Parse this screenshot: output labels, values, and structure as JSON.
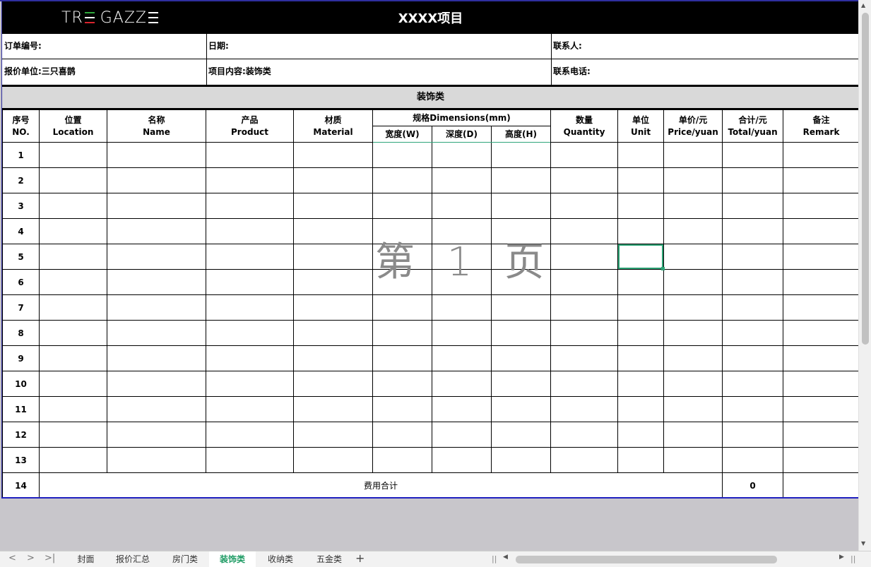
{
  "header": {
    "logo": "TRE GAZZE",
    "title": "XXXX项目",
    "logo_stripe_colors": [
      "#2fa83c",
      "#ffffff",
      "#d8242d"
    ]
  },
  "info": {
    "order_no_label": "订单编号:",
    "date_label": "日期:",
    "contact_label": "联系人:",
    "quote_unit_label": "报价单位:三只喜鹊",
    "project_content_label": "项目内容:装饰类",
    "phone_label": "联系电话:"
  },
  "section_title": "装饰类",
  "columns": {
    "no_cn": "序号",
    "no_en": "NO.",
    "loc_cn": "位置",
    "loc_en": "Location",
    "name_cn": "名称",
    "name_en": "Name",
    "prod_cn": "产品",
    "prod_en": "Product",
    "mat_cn": "材质",
    "mat_en": "Material",
    "dim": "规格Dimensions(mm)",
    "w": "宽度(W)",
    "d": "深度(D)",
    "h": "高度(H)",
    "qty_cn": "数量",
    "qty_en": "Quantity",
    "unit_cn": "单位",
    "unit_en": "Unit",
    "price_cn": "单价/元",
    "price_en": "Price/yuan",
    "total_cn": "合计/元",
    "total_en": "Total/yuan",
    "remark_cn": "备注",
    "remark_en": "Remark"
  },
  "rows": [
    "1",
    "2",
    "3",
    "4",
    "5",
    "6",
    "7",
    "8",
    "9",
    "10",
    "11",
    "12",
    "13"
  ],
  "total_row": {
    "no": "14",
    "label": "费用合计",
    "value": "0"
  },
  "watermark": "第 1 页",
  "tabs": [
    "封面",
    "报价汇总",
    "房门类",
    "装饰类",
    "收纳类",
    "五金类"
  ],
  "active_tab": "装饰类",
  "accent_color": "#1e9b64"
}
